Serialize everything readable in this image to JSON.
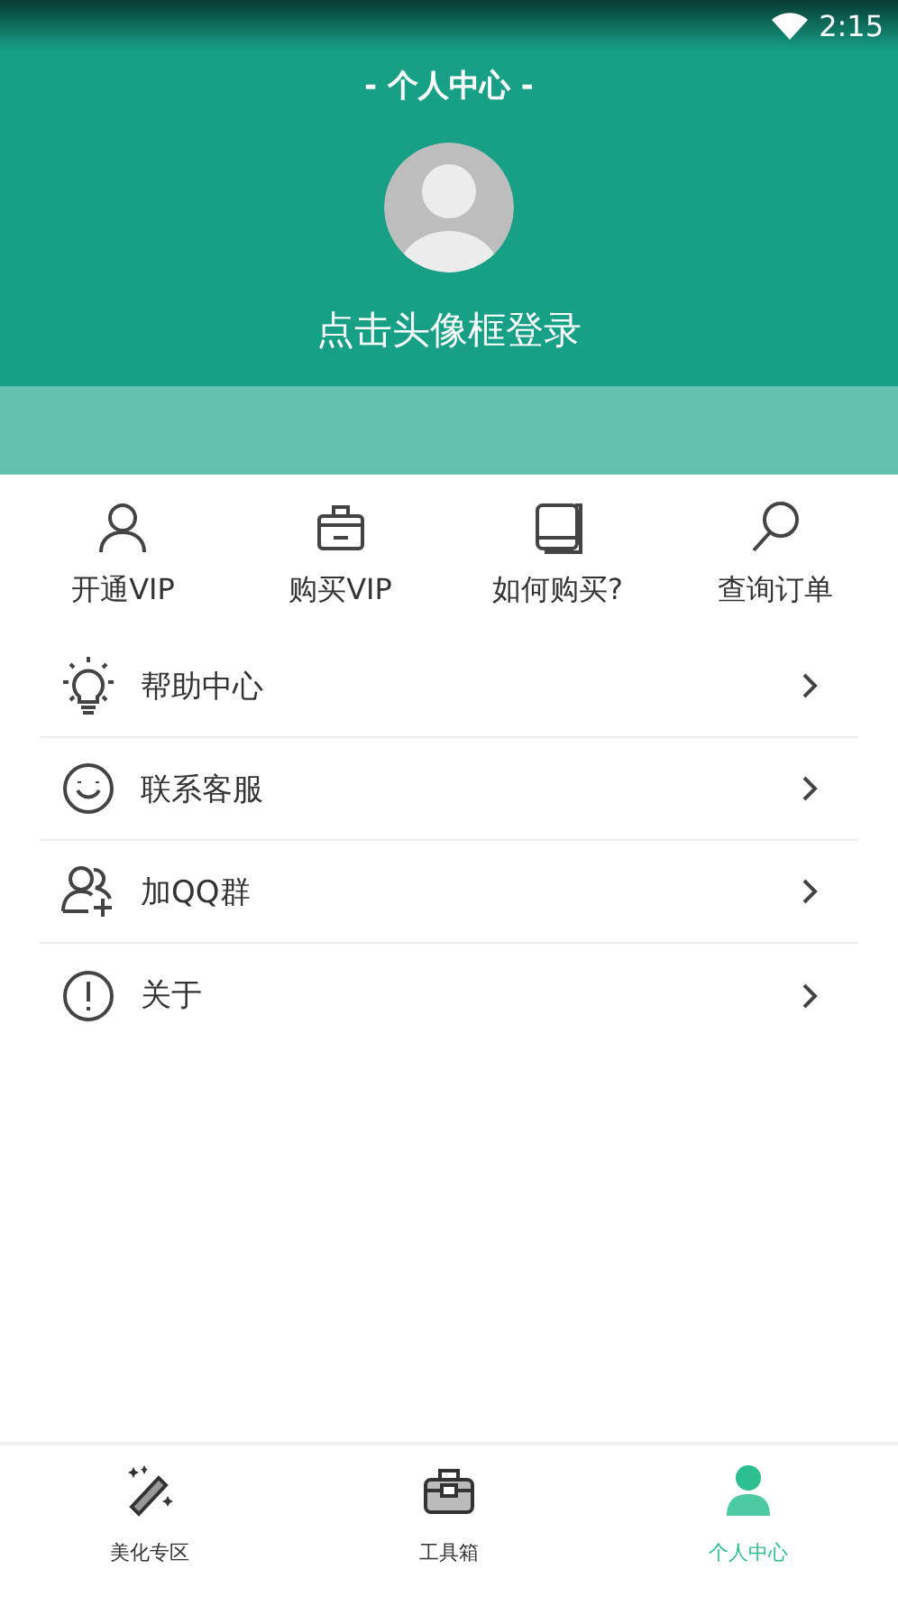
{
  "status_bar": {
    "time": "2:15"
  },
  "header": {
    "title": "- 个人中心 -",
    "login_prompt": "点击头像框登录"
  },
  "quick_actions": [
    {
      "kind": "person",
      "label": "开通VIP"
    },
    {
      "kind": "basket",
      "label": "购买VIP"
    },
    {
      "kind": "book",
      "label": "如何购买?"
    },
    {
      "kind": "search",
      "label": "查询订单"
    }
  ],
  "menu": [
    {
      "kind": "bulb",
      "label": "帮助中心"
    },
    {
      "kind": "smile",
      "label": "联系客服"
    },
    {
      "kind": "group",
      "label": "加QQ群"
    },
    {
      "kind": "info",
      "label": "关于"
    }
  ],
  "bottom_nav": [
    {
      "kind": "wand",
      "label": "美化专区",
      "selected": false
    },
    {
      "kind": "toolbox",
      "label": "工具箱",
      "selected": false
    },
    {
      "kind": "user",
      "label": "个人中心",
      "selected": true
    }
  ]
}
